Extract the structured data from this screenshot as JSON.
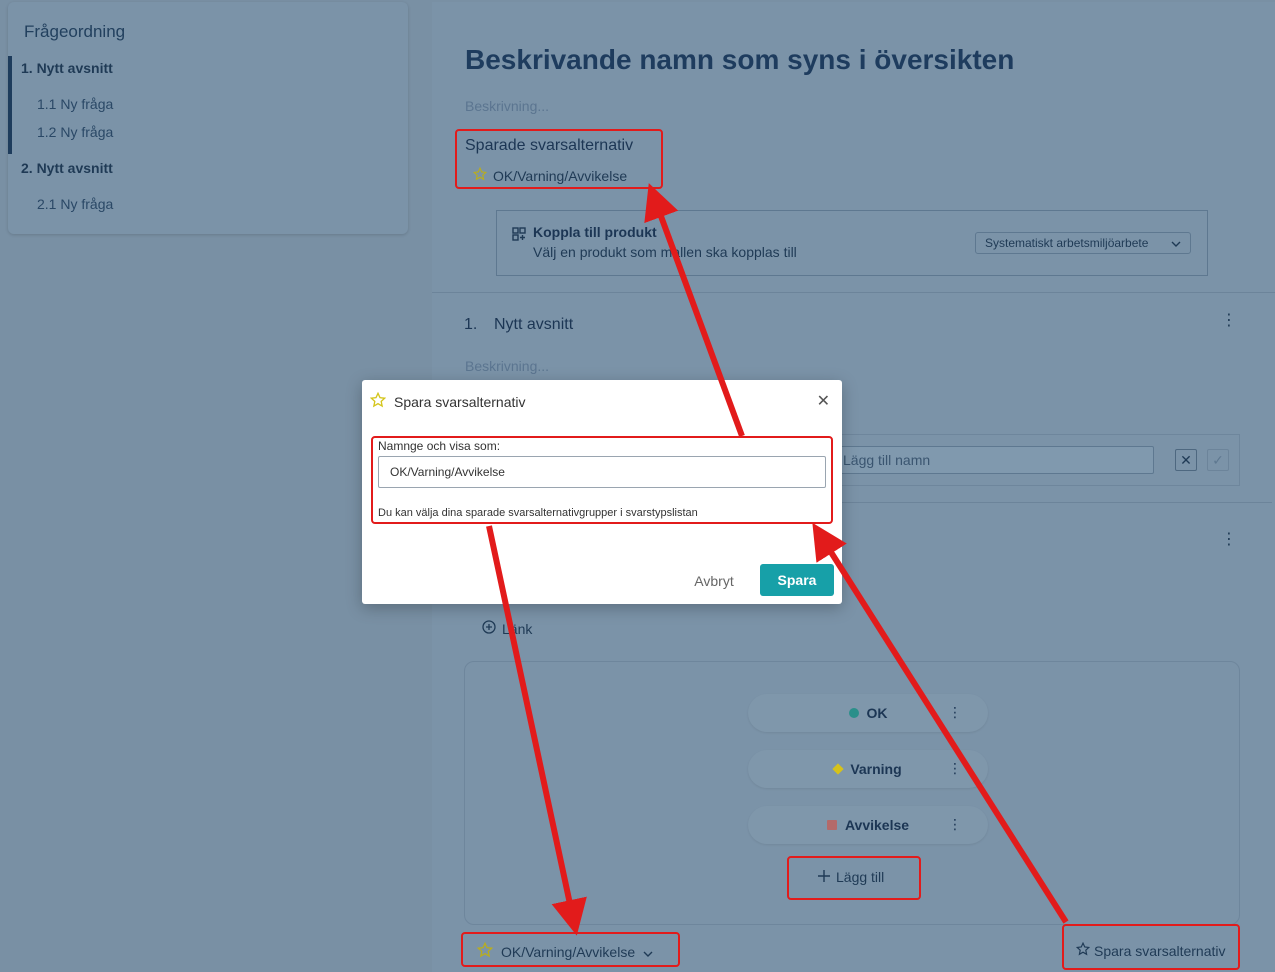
{
  "sidebar": {
    "title": "Frågeordning",
    "items": [
      {
        "label": "1.  Nytt avsnitt"
      },
      {
        "label": "1.1  Ny fråga"
      },
      {
        "label": "1.2  Ny fråga"
      },
      {
        "label": "2.  Nytt avsnitt"
      },
      {
        "label": "2.1  Ny fråga"
      }
    ]
  },
  "main": {
    "title": "Beskrivande namn som syns i översikten",
    "description_placeholder": "Beskrivning...",
    "saved_heading": "Sparade svarsalternativ",
    "saved_item": "OK/Varning/Avvikelse",
    "product": {
      "title": "Koppla till produkt",
      "subtitle": "Välj en produkt som mallen ska kopplas till",
      "selected": "Systematiskt arbetsmiljöarbete"
    },
    "section": {
      "number": "1.",
      "title": "Nytt avsnitt",
      "description_placeholder": "Beskrivning..."
    },
    "name_placeholder": "Lägg till namn",
    "link_label": "Länk",
    "answers": [
      {
        "label": "OK",
        "color": "#2a8f8a"
      },
      {
        "label": "Varning",
        "color": "#d6c21a"
      },
      {
        "label": "Avvikelse",
        "color": "#b46a6a"
      }
    ],
    "add_label": "Lägg till",
    "bottom_select": "OK/Varning/Avvikelse",
    "save_alternative": "Spara svarsalternativ"
  },
  "modal": {
    "title": "Spara svarsalternativ",
    "field_label": "Namnge och visa som:",
    "field_value": "OK/Varning/Avvikelse",
    "hint": "Du kan välja dina sparade svarsalternativgrupper i svarstypslistan",
    "cancel": "Avbryt",
    "save": "Spara"
  },
  "colors": {
    "accent": "#17a0a8",
    "annotation": "#e21b1b",
    "star": "#d4c51c"
  }
}
